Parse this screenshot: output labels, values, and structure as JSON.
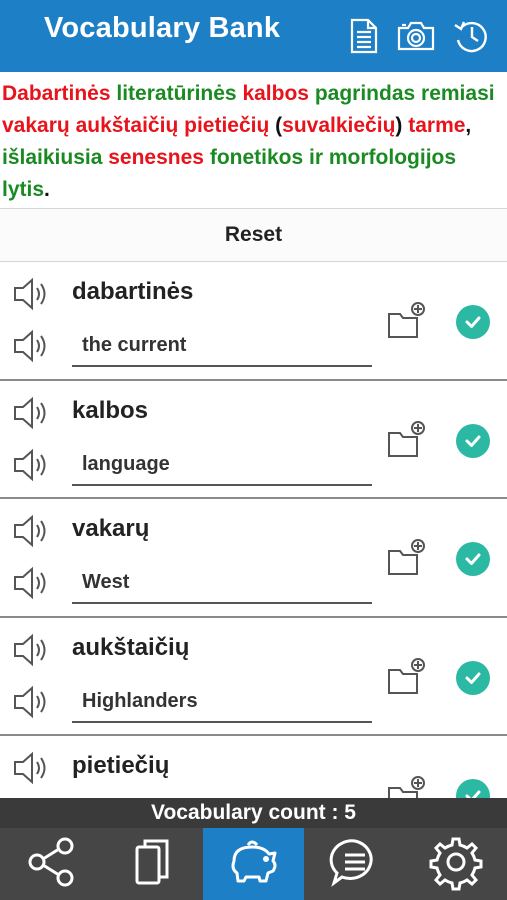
{
  "header": {
    "title": "Vocabulary Bank",
    "icons": [
      "document-icon",
      "camera-icon",
      "history-icon"
    ]
  },
  "sentence": {
    "words": [
      {
        "text": "Dabartinės",
        "color": "red"
      },
      {
        "text": " ",
        "color": "black"
      },
      {
        "text": "literatūrinės",
        "color": "green"
      },
      {
        "text": " ",
        "color": "black"
      },
      {
        "text": "kalbos",
        "color": "red"
      },
      {
        "text": " ",
        "color": "black"
      },
      {
        "text": "pagrindas",
        "color": "green"
      },
      {
        "text": " ",
        "color": "black"
      },
      {
        "text": "remiasi",
        "color": "green"
      },
      {
        "text": " ",
        "color": "black"
      },
      {
        "text": "vakarų",
        "color": "red"
      },
      {
        "text": " ",
        "color": "black"
      },
      {
        "text": "aukštaičių",
        "color": "red"
      },
      {
        "text": " ",
        "color": "black"
      },
      {
        "text": "pietiečių",
        "color": "red"
      },
      {
        "text": " (",
        "color": "black"
      },
      {
        "text": "suvalkiečių",
        "color": "red"
      },
      {
        "text": ") ",
        "color": "black"
      },
      {
        "text": "tarme",
        "color": "red"
      },
      {
        "text": ", ",
        "color": "black"
      },
      {
        "text": "išlaikiusia",
        "color": "green"
      },
      {
        "text": " ",
        "color": "black"
      },
      {
        "text": "senesnes",
        "color": "red"
      },
      {
        "text": " ",
        "color": "black"
      },
      {
        "text": "fonetikos",
        "color": "green"
      },
      {
        "text": " ",
        "color": "black"
      },
      {
        "text": "ir",
        "color": "green"
      },
      {
        "text": " ",
        "color": "black"
      },
      {
        "text": "morfologijos",
        "color": "green"
      },
      {
        "text": " ",
        "color": "black"
      },
      {
        "text": "lytis",
        "color": "green"
      },
      {
        "text": ".",
        "color": "black"
      }
    ]
  },
  "reset_label": "Reset",
  "vocabulary": [
    {
      "word": "dabartinės",
      "translation": "the current",
      "checked": true
    },
    {
      "word": "kalbos",
      "translation": "language",
      "checked": true
    },
    {
      "word": "vakarų",
      "translation": "West",
      "checked": true
    },
    {
      "word": "aukštaičių",
      "translation": "Highlanders",
      "checked": true
    },
    {
      "word": "pietiečių",
      "translation": "",
      "checked": true
    }
  ],
  "count_label": "Vocabulary count : 5",
  "tabs": [
    {
      "icon": "share-icon",
      "active": false
    },
    {
      "icon": "copy-icon",
      "active": false
    },
    {
      "icon": "piggy-bank-icon",
      "active": true
    },
    {
      "icon": "chat-icon",
      "active": false
    },
    {
      "icon": "settings-icon",
      "active": false
    }
  ],
  "colors": {
    "header_blue": "#1d7fc6",
    "word_red": "#e8131b",
    "word_green": "#1a8a22",
    "check_teal": "#2bb9a3",
    "tabbar_gray": "#464646"
  }
}
